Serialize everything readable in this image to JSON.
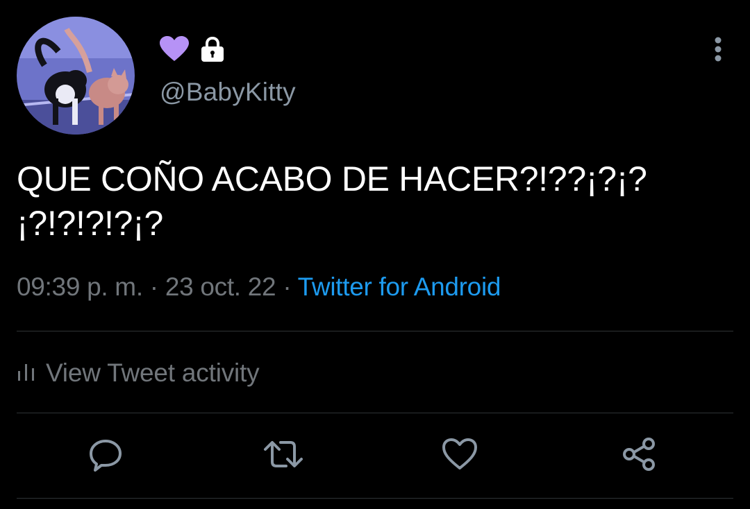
{
  "profile": {
    "handle": "@BabyKitty",
    "avatar_alt": "two cats avatar",
    "badges": [
      "purple-heart-icon",
      "lock-icon"
    ],
    "heart_color": "#b692f6"
  },
  "tweet": {
    "text": "QUE COÑO ACABO DE HACER?!??¡?¡?¡?!?!?!?¡?",
    "time": "09:39 p. m.",
    "separator": "·",
    "date": "23 oct. 22",
    "source": "Twitter for Android"
  },
  "activity": {
    "label": "View Tweet activity",
    "icon": "bar-chart-icon"
  },
  "actions": [
    {
      "name": "reply",
      "icon": "reply-icon"
    },
    {
      "name": "retweet",
      "icon": "retweet-icon"
    },
    {
      "name": "like",
      "icon": "like-icon"
    },
    {
      "name": "share",
      "icon": "share-icon"
    }
  ],
  "colors": {
    "background": "#000000",
    "primary_text": "#ffffff",
    "secondary_text": "#71767b",
    "link": "#1d9bf0",
    "divider": "#2f3336"
  }
}
